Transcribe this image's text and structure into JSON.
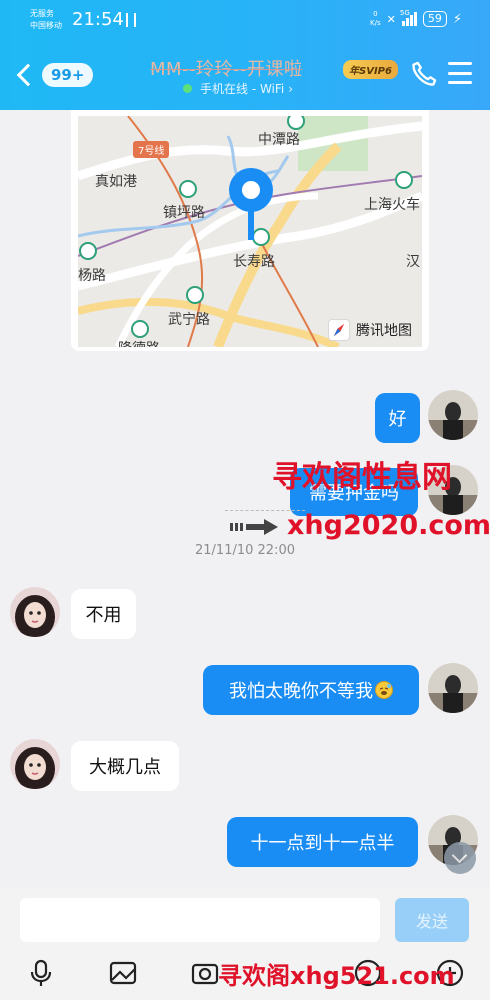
{
  "status_bar": {
    "carrier_line1": "无服务",
    "carrier_line2": "中国移动",
    "time": "21:54",
    "net_speed_value": "0",
    "net_speed_unit": "K/s",
    "network_type": "5G",
    "battery": "59"
  },
  "header": {
    "unread_count": "99+",
    "contact_name": "MM--玲玲--开课啦",
    "vip_badge": "年SVIP6",
    "online_status": "手机在线 - WiFi",
    "status_chevron": "›"
  },
  "map": {
    "labels": [
      "中潭路",
      "7号线",
      "真如港",
      "镇坪路",
      "上海火车",
      "长寿路",
      "杨路",
      "武宁路",
      "汉",
      "隆德路"
    ],
    "attribution": "腾讯地图"
  },
  "messages": [
    {
      "direction": "out",
      "text": "好"
    },
    {
      "direction": "out",
      "text": "需要押金吗"
    },
    {
      "direction": "in",
      "text": "不用"
    },
    {
      "direction": "out",
      "text": "我怕太晚你不等我"
    },
    {
      "direction": "in",
      "text": "大概几点"
    },
    {
      "direction": "out",
      "text": "十一点到十一点半"
    }
  ],
  "timestamp": "21/11/10 22:00",
  "watermarks": {
    "site_name": "寻欢阁性息网",
    "site_url": "xhg2020.com",
    "bottom_text": "寻欢阁xhg521.com"
  },
  "input": {
    "value": "",
    "send_label": "发送"
  },
  "toolbar_icons": [
    "mic-icon",
    "image-icon",
    "camera-icon",
    "emoji-icon",
    "plus-icon"
  ],
  "colors": {
    "header_gradient_start": "#1fb8f5",
    "header_gradient_end": "#38a8f8",
    "outgoing_bubble": "#1a8df5",
    "incoming_bubble": "#ffffff",
    "chat_background": "#f1f1f3",
    "send_button_disabled": "#97cff8",
    "watermark": "#e0122a"
  }
}
